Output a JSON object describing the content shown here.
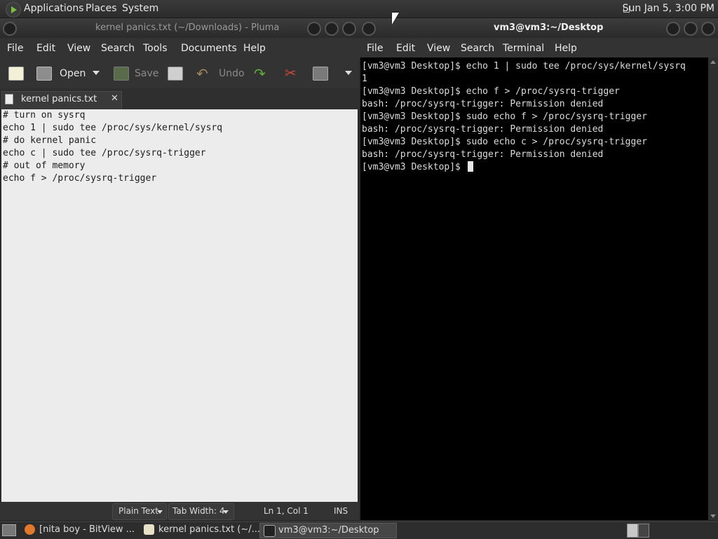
{
  "top_panel": {
    "menus": [
      "Applications",
      "Places",
      "System"
    ],
    "clock": "Sun Jan  5,  3:00 PM"
  },
  "pluma": {
    "title": "kernel panics.txt (~/Downloads) - Pluma",
    "menus": [
      "File",
      "Edit",
      "View",
      "Search",
      "Tools",
      "Documents",
      "Help"
    ],
    "toolbar": {
      "open": "Open",
      "save": "Save",
      "undo": "Undo"
    },
    "tab": "kernel panics.txt",
    "close_glyph": "✕",
    "lines": [
      "# turn on sysrq",
      "echo 1 | sudo tee /proc/sys/kernel/sysrq",
      "# do kernel panic",
      "echo c | sudo tee /proc/sysrq-trigger",
      "# out of memory",
      "echo f > /proc/sysrq-trigger"
    ],
    "status": {
      "syntax": "Plain Text",
      "tab_width": "Tab Width:  4",
      "position": "Ln 1, Col 1",
      "mode": "INS"
    }
  },
  "terminal": {
    "title": "vm3@vm3:~/Desktop",
    "menus": [
      "File",
      "Edit",
      "View",
      "Search",
      "Terminal",
      "Help"
    ],
    "lines": [
      "[vm3@vm3 Desktop]$ echo 1 | sudo tee /proc/sys/kernel/sysrq",
      "1",
      "[vm3@vm3 Desktop]$ echo f > /proc/sysrq-trigger",
      "bash: /proc/sysrq-trigger: Permission denied",
      "[vm3@vm3 Desktop]$ sudo echo f > /proc/sysrq-trigger",
      "bash: /proc/sysrq-trigger: Permission denied",
      "[vm3@vm3 Desktop]$ sudo echo c > /proc/sysrq-trigger",
      "bash: /proc/sysrq-trigger: Permission denied"
    ],
    "prompt": "[vm3@vm3 Desktop]$ "
  },
  "taskbar": {
    "tasks": [
      "[nita boy - BitView ...",
      "kernel panics.txt (~/...",
      "vm3@vm3:~/Desktop"
    ]
  },
  "colors": {
    "terminal_bg": "#000000",
    "editor_bg": "#ececec",
    "panel_bg": "#2d2d2d",
    "logo_green": "#7cbf3e"
  }
}
